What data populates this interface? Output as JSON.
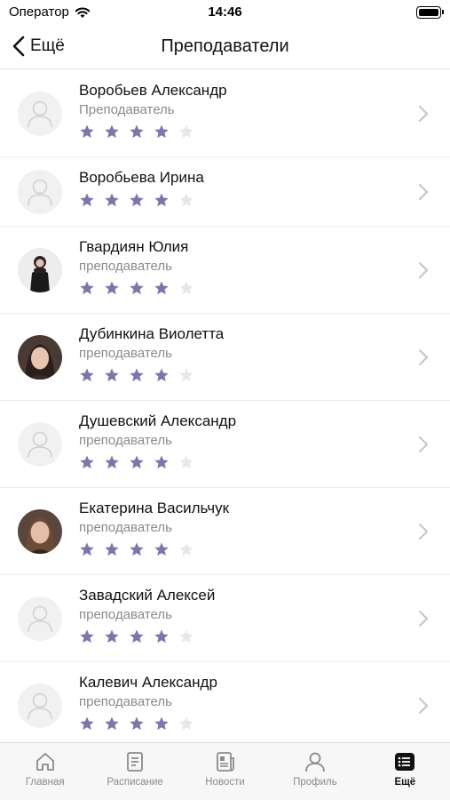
{
  "status_bar": {
    "carrier": "Оператор",
    "time": "14:46"
  },
  "nav": {
    "back_label": "Ещё",
    "title": "Преподаватели"
  },
  "accent_color": "#7d76a8",
  "teachers": [
    {
      "name": "Воробьев Александр",
      "role": "Преподаватель",
      "rating": 4,
      "max_rating": 5,
      "avatar": "placeholder"
    },
    {
      "name": "Воробьева Ирина",
      "role": "",
      "rating": 4,
      "max_rating": 5,
      "avatar": "placeholder"
    },
    {
      "name": "Гвардиян Юлия",
      "role": "преподаватель",
      "rating": 4,
      "max_rating": 5,
      "avatar": "photo"
    },
    {
      "name": "Дубинкина Виолетта",
      "role": "преподаватель",
      "rating": 4,
      "max_rating": 5,
      "avatar": "photo"
    },
    {
      "name": "Душевский Александр",
      "role": "преподаватель",
      "rating": 4,
      "max_rating": 5,
      "avatar": "placeholder"
    },
    {
      "name": "Екатерина Васильчук",
      "role": "преподаватель",
      "rating": 4,
      "max_rating": 5,
      "avatar": "photo"
    },
    {
      "name": "Завадский Алексей",
      "role": "преподаватель",
      "rating": 4,
      "max_rating": 5,
      "avatar": "placeholder"
    },
    {
      "name": "Калевич Александр",
      "role": "преподаватель",
      "rating": 4,
      "max_rating": 5,
      "avatar": "placeholder"
    }
  ],
  "tabs": [
    {
      "label": "Главная",
      "icon": "home-icon",
      "active": false
    },
    {
      "label": "Расписание",
      "icon": "schedule-icon",
      "active": false
    },
    {
      "label": "Новости",
      "icon": "news-icon",
      "active": false
    },
    {
      "label": "Профиль",
      "icon": "profile-icon",
      "active": false
    },
    {
      "label": "Ещё",
      "icon": "more-icon",
      "active": true
    }
  ]
}
